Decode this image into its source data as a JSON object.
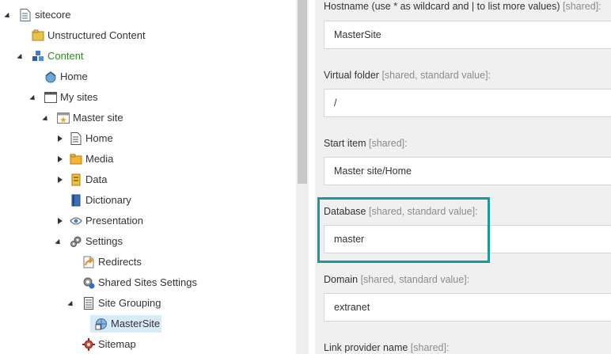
{
  "tree": {
    "root": "sitecore",
    "unstructured": "Unstructured Content",
    "content": "Content",
    "home": "Home",
    "my_sites": "My sites",
    "master_site": "Master site",
    "ms_home": "Home",
    "media": "Media",
    "data": "Data",
    "dictionary": "Dictionary",
    "presentation": "Presentation",
    "settings": "Settings",
    "redirects": "Redirects",
    "shared_sites_settings": "Shared Sites Settings",
    "site_grouping": "Site Grouping",
    "mastersite": "MasterSite",
    "sitemap": "Sitemap"
  },
  "fields": {
    "hostname": {
      "label": "Hostname (use * as wildcard and | to list more values)",
      "tag": "[shared]:",
      "value": "MasterSite"
    },
    "virtual_folder": {
      "label": "Virtual folder",
      "tag": "[shared, standard value]:",
      "value": "/"
    },
    "start_item": {
      "label": "Start item",
      "tag": "[shared]:",
      "value": "Master site/Home"
    },
    "database": {
      "label": "Database",
      "tag": "[shared, standard value]:",
      "value": "master"
    },
    "domain": {
      "label": "Domain",
      "tag": "[shared, standard value]:",
      "value": "extranet"
    },
    "link_provider": {
      "label": "Link provider name",
      "tag": "[shared]:"
    }
  },
  "colors": {
    "highlight": "#1a9a9a",
    "content_label": "#2f8a26",
    "selected_bg": "#d7ecf9"
  }
}
